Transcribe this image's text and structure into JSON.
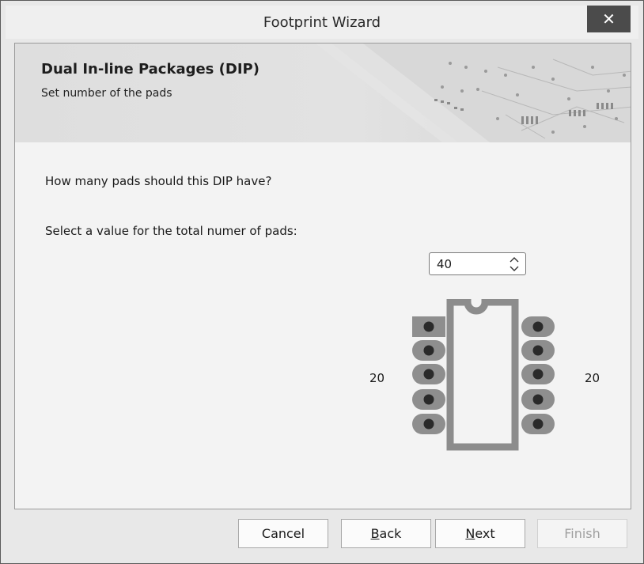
{
  "window": {
    "title": "Footprint Wizard",
    "close_glyph": "✕"
  },
  "banner": {
    "title": "Dual In-line Packages (DIP)",
    "subtitle": "Set number of the pads"
  },
  "main": {
    "question": "How many pads should this DIP have?",
    "select_label": "Select a value for the total numer of pads:",
    "pad_count": {
      "value": "40"
    },
    "left_count": "20",
    "right_count": "20"
  },
  "footer": {
    "cancel": "Cancel",
    "back_accel": "B",
    "back_rest": "ack",
    "next_accel": "N",
    "next_rest": "ext",
    "finish": "Finish"
  },
  "icons": {
    "close": "close-icon",
    "spin_up": "chevron-up-icon",
    "spin_down": "chevron-down-icon"
  }
}
